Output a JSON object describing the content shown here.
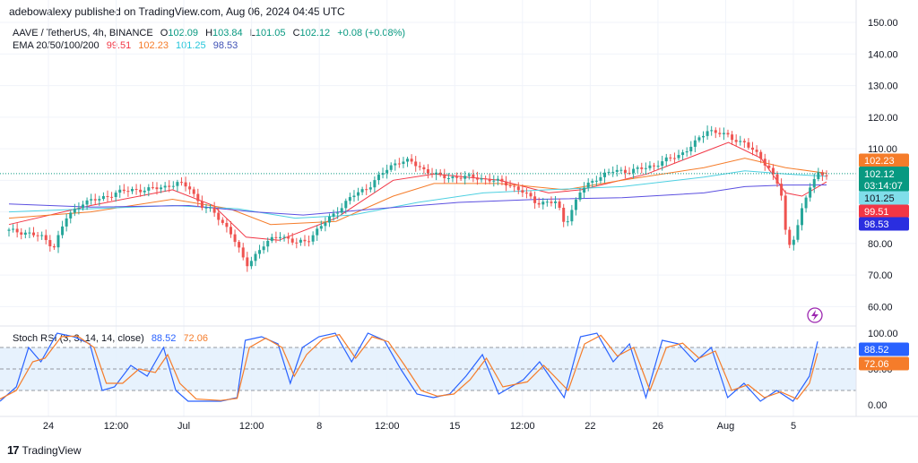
{
  "publisher": "adebowalexy published on TradingView.com, Aug 06, 2024 04:45 UTC",
  "symbol": {
    "name": "AAVE / TetherUS, 4h, BINANCE",
    "open_label": "O",
    "open": "102.09",
    "high_label": "H",
    "high": "103.84",
    "low_label": "L",
    "low": "101.05",
    "close_label": "C",
    "close": "102.12",
    "change": "+0.08 (+0.08%)"
  },
  "ema": {
    "label": "EMA 20/50/100/200",
    "values": [
      "99.51",
      "102.23",
      "101.25",
      "98.53"
    ]
  },
  "rsi": {
    "label": "Stoch RSI (3, 3, 14, 14, close)",
    "k": "88.52",
    "d": "72.06"
  },
  "footer": {
    "logo": "17",
    "brand": "TradingView"
  },
  "badge_timer": "03:14:07",
  "colors": {
    "up": "#26a69a",
    "down": "#ef5350",
    "ema20": "#f23645",
    "ema50": "#f57c2a",
    "ema100": "#4dd0e1",
    "ema200": "#5b4fe0",
    "k": "#2962ff",
    "d": "#f57c2a",
    "close_badge": "#089981"
  },
  "chart_data": [
    {
      "type": "candlestick",
      "title": "AAVE / TetherUS, 4h, BINANCE",
      "x_ticks": [
        "24",
        "12:00",
        "Jul",
        "12:00",
        "8",
        "12:00",
        "15",
        "12:00",
        "22",
        "26",
        "Aug",
        "5"
      ],
      "y_ticks": [
        "150.00",
        "140.00",
        "130.00",
        "120.00",
        "110.00",
        "100.00",
        "90.00",
        "80.00",
        "70.00",
        "60.00"
      ],
      "ylim": [
        55,
        152
      ],
      "grid": true,
      "price_path": [
        [
          0,
          84
        ],
        [
          0.02,
          83.5
        ],
        [
          0.04,
          82
        ],
        [
          0.055,
          79
        ],
        [
          0.07,
          88
        ],
        [
          0.09,
          93
        ],
        [
          0.11,
          94
        ],
        [
          0.13,
          96
        ],
        [
          0.15,
          97
        ],
        [
          0.17,
          97
        ],
        [
          0.19,
          98
        ],
        [
          0.205,
          99
        ],
        [
          0.22,
          98
        ],
        [
          0.235,
          92
        ],
        [
          0.25,
          90
        ],
        [
          0.27,
          84
        ],
        [
          0.285,
          76
        ],
        [
          0.29,
          73
        ],
        [
          0.31,
          79
        ],
        [
          0.33,
          83
        ],
        [
          0.35,
          80
        ],
        [
          0.365,
          81
        ],
        [
          0.38,
          85
        ],
        [
          0.4,
          90
        ],
        [
          0.42,
          95
        ],
        [
          0.44,
          98
        ],
        [
          0.46,
          103
        ],
        [
          0.475,
          106
        ],
        [
          0.49,
          106
        ],
        [
          0.51,
          103
        ],
        [
          0.53,
          101
        ],
        [
          0.55,
          101
        ],
        [
          0.57,
          101
        ],
        [
          0.59,
          100
        ],
        [
          0.61,
          99
        ],
        [
          0.63,
          96
        ],
        [
          0.645,
          93
        ],
        [
          0.66,
          93
        ],
        [
          0.67,
          93
        ],
        [
          0.68,
          86
        ],
        [
          0.7,
          97
        ],
        [
          0.72,
          101
        ],
        [
          0.74,
          103
        ],
        [
          0.76,
          103
        ],
        [
          0.78,
          104
        ],
        [
          0.8,
          106
        ],
        [
          0.82,
          108
        ],
        [
          0.84,
          112
        ],
        [
          0.855,
          116
        ],
        [
          0.87,
          115
        ],
        [
          0.885,
          113
        ],
        [
          0.9,
          112
        ],
        [
          0.915,
          108
        ],
        [
          0.93,
          104
        ],
        [
          0.94,
          99
        ],
        [
          0.945,
          95
        ],
        [
          0.95,
          83
        ],
        [
          0.955,
          79
        ],
        [
          0.96,
          82
        ],
        [
          0.97,
          91
        ],
        [
          0.98,
          98
        ],
        [
          0.99,
          102
        ],
        [
          1,
          102.12
        ]
      ],
      "series": [
        {
          "name": "EMA 20",
          "points": [
            [
              0,
              86
            ],
            [
              0.1,
              92
            ],
            [
              0.2,
              97
            ],
            [
              0.25,
              92
            ],
            [
              0.29,
              82
            ],
            [
              0.33,
              81
            ],
            [
              0.4,
              88
            ],
            [
              0.47,
              100
            ],
            [
              0.52,
              102
            ],
            [
              0.6,
              100
            ],
            [
              0.66,
              96
            ],
            [
              0.7,
              97
            ],
            [
              0.78,
              102
            ],
            [
              0.85,
              109
            ],
            [
              0.88,
              112
            ],
            [
              0.92,
              107
            ],
            [
              0.95,
              96
            ],
            [
              0.97,
              95
            ],
            [
              1,
              99.51
            ]
          ]
        },
        {
          "name": "EMA 50",
          "points": [
            [
              0,
              88
            ],
            [
              0.1,
              90
            ],
            [
              0.2,
              94
            ],
            [
              0.27,
              91
            ],
            [
              0.32,
              86
            ],
            [
              0.4,
              87
            ],
            [
              0.47,
              95
            ],
            [
              0.52,
              99
            ],
            [
              0.6,
              99
            ],
            [
              0.68,
              97
            ],
            [
              0.75,
              100
            ],
            [
              0.85,
              104
            ],
            [
              0.9,
              107
            ],
            [
              0.95,
              104
            ],
            [
              1,
              102.23
            ]
          ]
        },
        {
          "name": "EMA 100",
          "points": [
            [
              0,
              90
            ],
            [
              0.1,
              91
            ],
            [
              0.2,
              92
            ],
            [
              0.28,
              91
            ],
            [
              0.35,
              88
            ],
            [
              0.42,
              89
            ],
            [
              0.5,
              93
            ],
            [
              0.58,
              96
            ],
            [
              0.66,
              97
            ],
            [
              0.75,
              98
            ],
            [
              0.85,
              101
            ],
            [
              0.9,
              103
            ],
            [
              0.95,
              102
            ],
            [
              1,
              101.25
            ]
          ]
        },
        {
          "name": "EMA 200",
          "points": [
            [
              0,
              92.5
            ],
            [
              0.1,
              91.5
            ],
            [
              0.22,
              92
            ],
            [
              0.3,
              90
            ],
            [
              0.36,
              89
            ],
            [
              0.45,
              91
            ],
            [
              0.55,
              93
            ],
            [
              0.65,
              94
            ],
            [
              0.75,
              94.5
            ],
            [
              0.85,
              96
            ],
            [
              0.9,
              98
            ],
            [
              0.95,
              98.5
            ],
            [
              1,
              98.53
            ]
          ]
        }
      ],
      "current_price": "102.12",
      "badges": [
        "102.23",
        "102.12",
        "101.25",
        "99.51",
        "98.53"
      ]
    },
    {
      "type": "line",
      "title": "Stoch RSI (3, 3, 14, 14, close)",
      "y_ticks": [
        "100.00",
        "50.00",
        "0.00"
      ],
      "ylim": [
        -10,
        105
      ],
      "bands": [
        20,
        80
      ],
      "series": [
        {
          "name": "K",
          "points": [
            [
              0,
              5
            ],
            [
              0.02,
              25
            ],
            [
              0.035,
              80
            ],
            [
              0.05,
              60
            ],
            [
              0.07,
              100
            ],
            [
              0.09,
              95
            ],
            [
              0.11,
              85
            ],
            [
              0.125,
              20
            ],
            [
              0.14,
              25
            ],
            [
              0.16,
              55
            ],
            [
              0.18,
              40
            ],
            [
              0.2,
              80
            ],
            [
              0.215,
              20
            ],
            [
              0.23,
              5
            ],
            [
              0.27,
              5
            ],
            [
              0.29,
              10
            ],
            [
              0.3,
              90
            ],
            [
              0.32,
              95
            ],
            [
              0.34,
              85
            ],
            [
              0.355,
              30
            ],
            [
              0.37,
              80
            ],
            [
              0.39,
              95
            ],
            [
              0.41,
              100
            ],
            [
              0.43,
              60
            ],
            [
              0.45,
              100
            ],
            [
              0.47,
              90
            ],
            [
              0.49,
              50
            ],
            [
              0.51,
              15
            ],
            [
              0.53,
              10
            ],
            [
              0.55,
              15
            ],
            [
              0.57,
              40
            ],
            [
              0.59,
              70
            ],
            [
              0.61,
              15
            ],
            [
              0.64,
              35
            ],
            [
              0.66,
              60
            ],
            [
              0.69,
              10
            ],
            [
              0.71,
              95
            ],
            [
              0.73,
              100
            ],
            [
              0.75,
              60
            ],
            [
              0.77,
              85
            ],
            [
              0.79,
              10
            ],
            [
              0.81,
              90
            ],
            [
              0.83,
              85
            ],
            [
              0.85,
              60
            ],
            [
              0.87,
              80
            ],
            [
              0.89,
              10
            ],
            [
              0.91,
              30
            ],
            [
              0.93,
              5
            ],
            [
              0.95,
              20
            ],
            [
              0.97,
              5
            ],
            [
              0.99,
              40
            ],
            [
              1,
              88.52
            ]
          ]
        },
        {
          "name": "D",
          "points": [
            [
              0,
              8
            ],
            [
              0.02,
              20
            ],
            [
              0.04,
              60
            ],
            [
              0.055,
              65
            ],
            [
              0.075,
              95
            ],
            [
              0.095,
              96
            ],
            [
              0.115,
              80
            ],
            [
              0.13,
              30
            ],
            [
              0.15,
              30
            ],
            [
              0.17,
              50
            ],
            [
              0.19,
              45
            ],
            [
              0.205,
              70
            ],
            [
              0.22,
              30
            ],
            [
              0.24,
              8
            ],
            [
              0.27,
              6
            ],
            [
              0.29,
              9
            ],
            [
              0.305,
              80
            ],
            [
              0.325,
              93
            ],
            [
              0.345,
              80
            ],
            [
              0.36,
              40
            ],
            [
              0.375,
              70
            ],
            [
              0.395,
              92
            ],
            [
              0.415,
              98
            ],
            [
              0.435,
              65
            ],
            [
              0.455,
              95
            ],
            [
              0.475,
              88
            ],
            [
              0.495,
              55
            ],
            [
              0.515,
              20
            ],
            [
              0.535,
              12
            ],
            [
              0.555,
              15
            ],
            [
              0.575,
              35
            ],
            [
              0.595,
              65
            ],
            [
              0.615,
              25
            ],
            [
              0.645,
              32
            ],
            [
              0.665,
              55
            ],
            [
              0.695,
              20
            ],
            [
              0.715,
              85
            ],
            [
              0.735,
              97
            ],
            [
              0.755,
              68
            ],
            [
              0.775,
              80
            ],
            [
              0.795,
              20
            ],
            [
              0.815,
              80
            ],
            [
              0.835,
              86
            ],
            [
              0.855,
              65
            ],
            [
              0.875,
              75
            ],
            [
              0.895,
              20
            ],
            [
              0.915,
              28
            ],
            [
              0.935,
              10
            ],
            [
              0.955,
              18
            ],
            [
              0.975,
              8
            ],
            [
              0.99,
              30
            ],
            [
              1,
              72.06
            ]
          ]
        }
      ]
    }
  ]
}
